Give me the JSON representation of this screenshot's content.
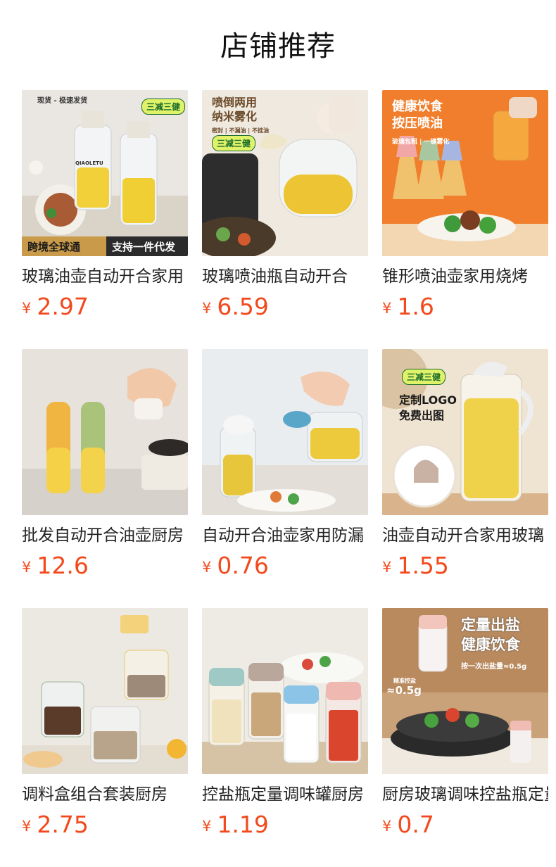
{
  "page": {
    "title": "店铺推荐"
  },
  "currency_symbol": "¥",
  "colors": {
    "price": "#f24a1d",
    "title": "#111111",
    "name": "#222222"
  },
  "products": [
    {
      "name": "玻璃油壶自动开合家用",
      "price": "2.97",
      "image_text": {
        "badge": "现货 - 极速发货",
        "tag": "三减三健",
        "banner_left": "跨境全球通",
        "banner_right": "支持一件代发",
        "brand": "QIAOLETU"
      }
    },
    {
      "name": "玻璃喷油瓶自动开合",
      "price": "6.59",
      "image_text": {
        "headline": "喷倒两用\n纳米雾化",
        "sub": "密封 | 不漏油 | 不挂油",
        "tag": "三减三健"
      }
    },
    {
      "name": "锥形喷油壶家用烧烤",
      "price": "1.6",
      "image_text": {
        "headline": "健康饮食\n按压喷油",
        "sub": "玻璃包粗 | 一键雾化"
      }
    },
    {
      "name": "批发自动开合油壶厨房",
      "price": "12.6",
      "image_text": {}
    },
    {
      "name": "自动开合油壶家用防漏",
      "price": "0.76",
      "image_text": {}
    },
    {
      "name": "油壶自动开合家用玻璃",
      "price": "1.55",
      "image_text": {
        "tag": "三减三健",
        "headline": "定制LOGO\n免费出图"
      }
    },
    {
      "name": "调料盒组合套装厨房",
      "price": "2.75",
      "image_text": {}
    },
    {
      "name": "控盐瓶定量调味罐厨房",
      "price": "1.19",
      "image_text": {}
    },
    {
      "name": "厨房玻璃调味控盐瓶定量",
      "price": "0.7",
      "image_text": {
        "headline": "定量出盐\n健康饮食",
        "sub": "按一次出盐量≈0.5g",
        "label": "精准控盐",
        "amount": "≈0.5g"
      }
    }
  ]
}
